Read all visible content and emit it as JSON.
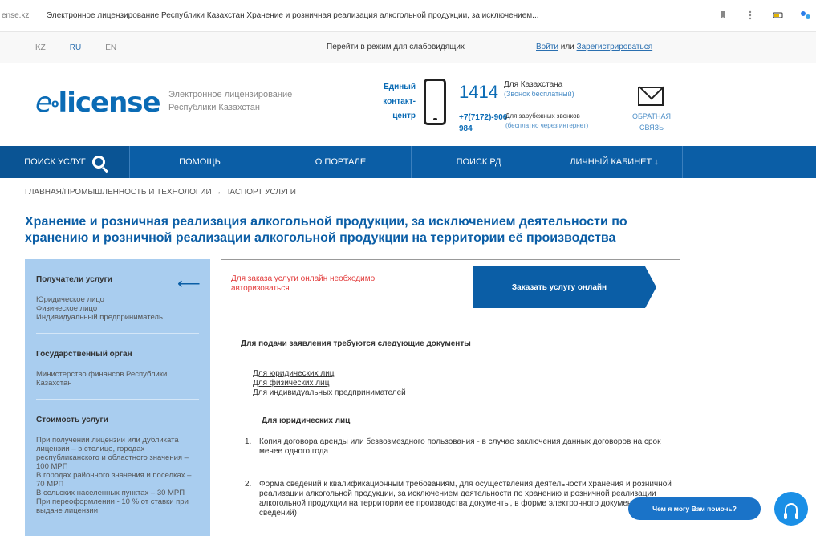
{
  "browser": {
    "host": "ense.kz",
    "tab_title": "Электронное лицензирование Республики Казахстан Хранение и розничная реализация алкогольной продукции, за исключением..."
  },
  "topbar": {
    "langs": [
      "KZ",
      "RU",
      "EN"
    ],
    "accessibility": "Перейти в режим для слабовидящих",
    "login": "Войти",
    "or": "или",
    "register": "Зарегистрироваться"
  },
  "header": {
    "logo": "e license",
    "logo_sub": "Электронное лицензирование Республики Казахстан",
    "contact_center": "Единый контакт-центр",
    "phone_short": "1414",
    "phone_short_label": "Для Казахстана",
    "phone_short_sub": "(Звонок бесплатный)",
    "phone_intl": "+7(7172)-906-984",
    "phone_intl_label": "Для зарубежных звонков",
    "phone_intl_sub": "(бесплатно через интернет)",
    "feedback": "ОБРАТНАЯ СВЯЗЬ"
  },
  "nav": {
    "items": [
      "ПОИСК УСЛУГ",
      "ПОМОЩЬ",
      "О ПОРТАЛЕ",
      "ПОИСК РД",
      "ЛИЧНЫЙ КАБИНЕТ ↓"
    ]
  },
  "breadcrumb": "ГЛАВНАЯ/ПРОМЫШЛЕННОСТЬ И ТЕХНОЛОГИИ → ПАСПОРТ УСЛУГИ",
  "page_title": "Хранение и розничная реализация алкогольной продукции, за исключением деятельности по хранению и розничной реализации алкогольной продукции на территории её производства",
  "sidebar": {
    "recipients_title": "Получатели услуги",
    "recipients_text": "Юридическое лицо\nФизическое лицо\nИндивидуальный предприниматель",
    "agency_title": "Государственный орган",
    "agency_text": "Министерство финансов Республики Казахстан",
    "cost_title": "Стоимость услуги",
    "cost_text": "При получении лицензии или дубликата лицензии – в столице, городах республиканского и областного значения – 100 МРП\nВ городах районного значения и поселках – 70 МРП\nВ сельских населенных пунктах – 30 МРП\nПри переоформлении - 10 % от ставки при выдаче лицензии"
  },
  "content": {
    "auth_note": "Для заказа услуги онлайн необходимо авторизоваться",
    "order_button": "Заказать услугу онлайн",
    "docs_title": "Для подачи заявления требуются следующие документы",
    "doc_links": [
      "Для юридических лиц",
      "Для физических лиц",
      "Для индивидуальных предпринимателей"
    ],
    "section_title": "Для юридических лиц",
    "requirements": [
      {
        "num": "1.",
        "text": "Копия договора аренды или безвозмездного пользования - в случае заключения данных договоров на срок менее одного года"
      },
      {
        "num": "2.",
        "text": "Форма сведений к квалификационным требованиям, для осуществления деятельности хранения и розничной реализации алкогольной продукции, за исключением деятельности по хранению и розничной реализации алкогольной продукции на территории ее производства документы, в форме электронного документа(форма сведений)"
      }
    ]
  },
  "help": {
    "bubble": "Чем я могу Вам помочь?"
  }
}
